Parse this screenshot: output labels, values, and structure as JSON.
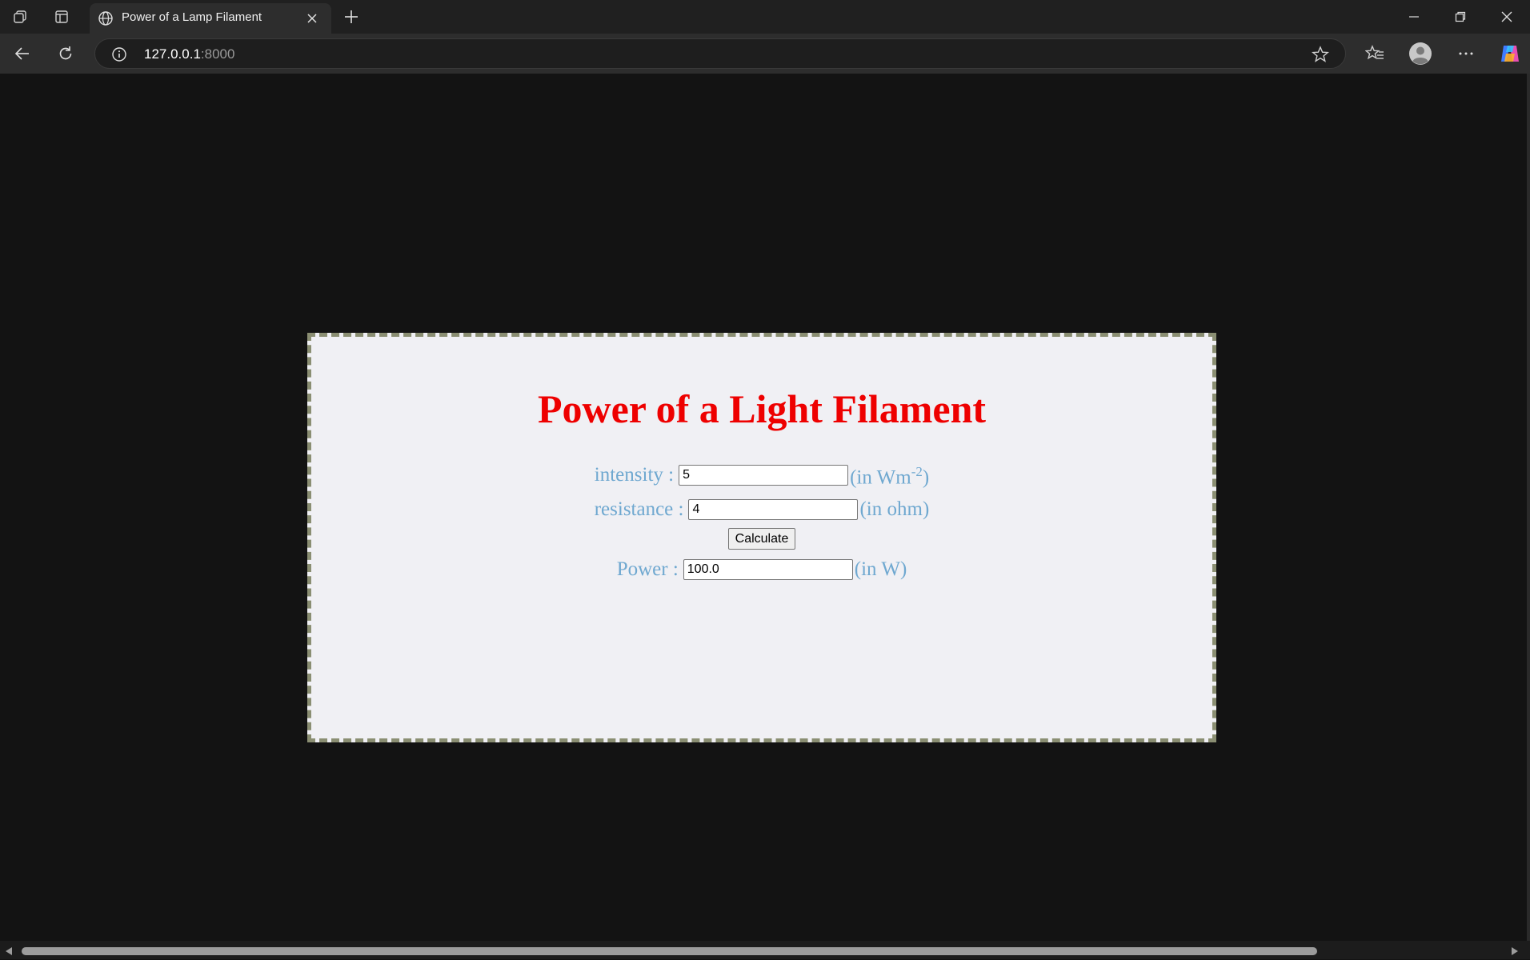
{
  "browser": {
    "tab_title": "Power of a Lamp Filament",
    "url_host": "127.0.0.1",
    "url_port": ":8000",
    "icons": [
      "workspaces-icon",
      "tab-actions-icon",
      "globe-icon",
      "close-icon",
      "new-tab-icon",
      "minimize-icon",
      "restore-icon",
      "window-close-icon",
      "back-icon",
      "refresh-icon",
      "info-icon",
      "favorite-star-icon",
      "favorites-icon",
      "profile-icon",
      "more-icon",
      "copilot-icon"
    ]
  },
  "page": {
    "heading": "Power of a Light Filament",
    "intensity": {
      "label": "intensity :",
      "value": "5",
      "unit_prefix": "(in Wm",
      "unit_sup": "-2",
      "unit_suffix": ")"
    },
    "resistance": {
      "label": "resistance :",
      "value": "4",
      "unit": "(in ohm)"
    },
    "calculate_label": "Calculate",
    "power": {
      "label": "Power :",
      "value": "100.0",
      "unit": "(in W)"
    }
  },
  "colors": {
    "heading": "#ee0000",
    "label": "#6fa8d0",
    "card_background": "#f0f0f4",
    "card_border": "#8a8e72",
    "page_background": "#131313"
  }
}
